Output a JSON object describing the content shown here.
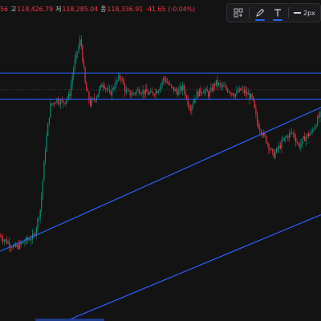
{
  "legend": {
    "open_fragment": "56",
    "high_label": "고",
    "high_value": "118,426.79",
    "low_label": "저",
    "low_value": "118,285.04",
    "close_label": "종",
    "close_value": "118,336.91",
    "change": "-41.65",
    "change_pct": "(-0.04%)",
    "up_color": "#089981",
    "down_color": "#f23645"
  },
  "toolbar": {
    "templates_icon": "grid-template-icon",
    "line_color_icon": "pencil-icon",
    "text_color_icon": "text-T-icon",
    "line_width_label": "2px",
    "accent_color": "#2962ff"
  },
  "drawings": {
    "line_color": "#2962ff",
    "horizontal_levels": [
      118650,
      118540
    ],
    "reference_level": 118580
  },
  "chart_data": {
    "type": "candlestick",
    "title": "",
    "xlabel": "",
    "ylabel": "",
    "ylim": [
      117600,
      118960
    ],
    "horizontal_lines": [
      118650,
      118540
    ],
    "trend_channel": {
      "upper": [
        [
          0,
          117895
        ],
        [
          400,
          118505
        ]
      ],
      "lower": [
        [
          75,
          117590
        ],
        [
          400,
          118050
        ]
      ]
    },
    "price_path": [
      [
        0,
        117960
      ],
      [
        10,
        117930
      ],
      [
        18,
        117910
      ],
      [
        26,
        117925
      ],
      [
        34,
        117945
      ],
      [
        42,
        117960
      ],
      [
        50,
        118080
      ],
      [
        56,
        118330
      ],
      [
        62,
        118510
      ],
      [
        70,
        118540
      ],
      [
        78,
        118525
      ],
      [
        86,
        118555
      ],
      [
        92,
        118690
      ],
      [
        100,
        118795
      ],
      [
        106,
        118590
      ],
      [
        112,
        118520
      ],
      [
        120,
        118555
      ],
      [
        128,
        118610
      ],
      [
        136,
        118560
      ],
      [
        144,
        118610
      ],
      [
        150,
        118640
      ],
      [
        156,
        118570
      ],
      [
        164,
        118560
      ],
      [
        172,
        118580
      ],
      [
        180,
        118570
      ],
      [
        188,
        118560
      ],
      [
        196,
        118580
      ],
      [
        204,
        118630
      ],
      [
        212,
        118590
      ],
      [
        220,
        118570
      ],
      [
        228,
        118590
      ],
      [
        236,
        118500
      ],
      [
        244,
        118560
      ],
      [
        252,
        118580
      ],
      [
        260,
        118560
      ],
      [
        268,
        118610
      ],
      [
        276,
        118590
      ],
      [
        284,
        118580
      ],
      [
        292,
        118560
      ],
      [
        300,
        118580
      ],
      [
        308,
        118560
      ],
      [
        314,
        118540
      ],
      [
        320,
        118440
      ],
      [
        326,
        118400
      ],
      [
        332,
        118360
      ],
      [
        340,
        118300
      ],
      [
        348,
        118340
      ],
      [
        356,
        118380
      ],
      [
        364,
        118400
      ],
      [
        372,
        118340
      ],
      [
        380,
        118380
      ],
      [
        388,
        118400
      ],
      [
        396,
        118460
      ],
      [
        400,
        118480
      ]
    ],
    "grid": false,
    "legend_position": "top-left"
  }
}
